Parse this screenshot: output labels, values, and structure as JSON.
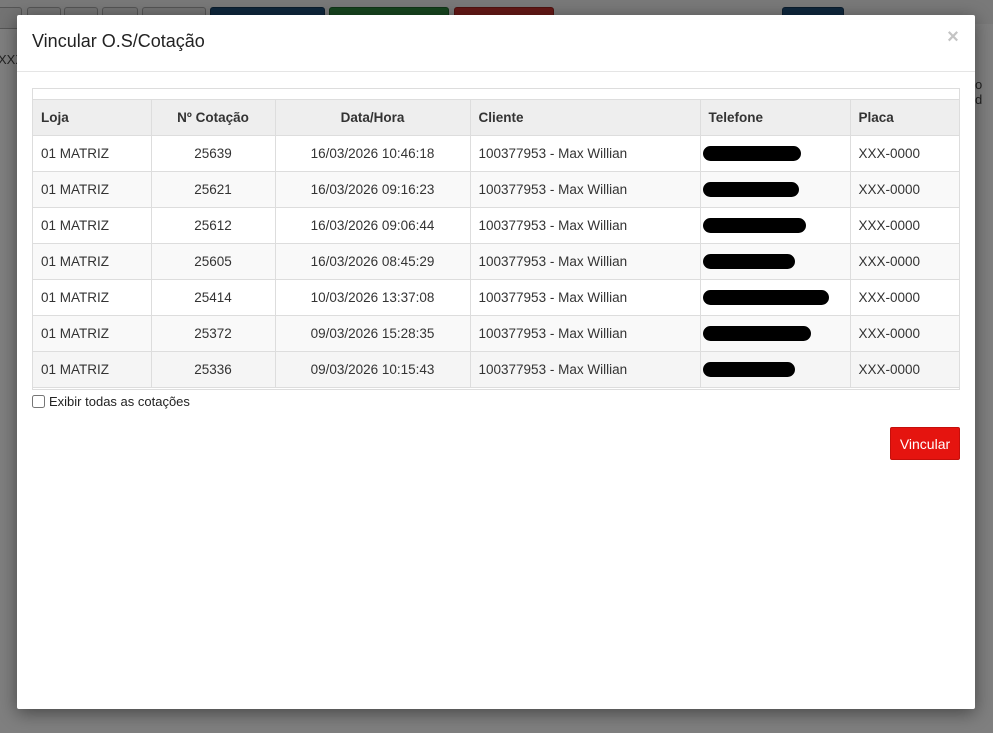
{
  "background": {
    "partial_text_left": "XXX",
    "partial_text_right": "o d"
  },
  "modal": {
    "title": "Vincular O.S/Cotação",
    "close_label": "×",
    "table": {
      "headers": [
        "Loja",
        "Nº Cotação",
        "Data/Hora",
        "Cliente",
        "Telefone",
        "Placa"
      ],
      "rows": [
        {
          "loja": "01 MATRIZ",
          "cotacao": "25639",
          "datahora": "16/03/2026 10:46:18",
          "cliente": "100377953 - Max Willian",
          "placa": "XXX-0000"
        },
        {
          "loja": "01 MATRIZ",
          "cotacao": "25621",
          "datahora": "16/03/2026 09:16:23",
          "cliente": "100377953 - Max Willian",
          "placa": "XXX-0000"
        },
        {
          "loja": "01 MATRIZ",
          "cotacao": "25612",
          "datahora": "16/03/2026 09:06:44",
          "cliente": "100377953 - Max Willian",
          "placa": "XXX-0000"
        },
        {
          "loja": "01 MATRIZ",
          "cotacao": "25605",
          "datahora": "16/03/2026 08:45:29",
          "cliente": "100377953 - Max Willian",
          "placa": "XXX-0000"
        },
        {
          "loja": "01 MATRIZ",
          "cotacao": "25414",
          "datahora": "10/03/2026 13:37:08",
          "cliente": "100377953 - Max Willian",
          "placa": "XXX-0000"
        },
        {
          "loja": "01 MATRIZ",
          "cotacao": "25372",
          "datahora": "09/03/2026 15:28:35",
          "cliente": "100377953 - Max Willian",
          "placa": "XXX-0000"
        },
        {
          "loja": "01 MATRIZ",
          "cotacao": "25336",
          "datahora": "09/03/2026 10:15:43",
          "cliente": "100377953 - Max Willian",
          "placa": "XXX-0000"
        }
      ]
    },
    "show_all_label": "Exibir todas as cotações",
    "show_all_checked": false,
    "submit_label": "Vincular",
    "colors": {
      "primary": "#e5140f",
      "header_bg": "#eeeeee"
    }
  }
}
